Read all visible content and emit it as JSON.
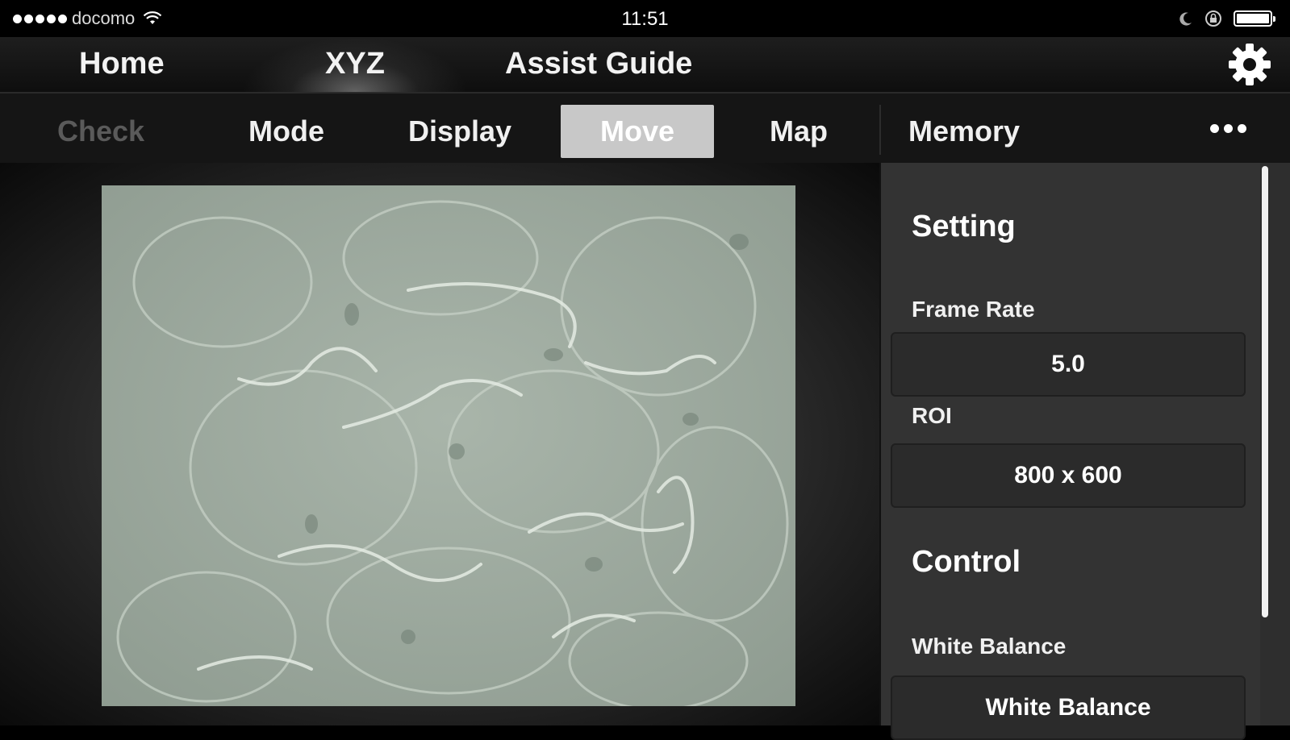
{
  "status_bar": {
    "carrier": "docomo",
    "time": "11:51"
  },
  "top_nav": {
    "items": [
      {
        "label": "Home",
        "active": false
      },
      {
        "label": "XYZ",
        "active": true
      },
      {
        "label": "Assist Guide",
        "active": false
      }
    ],
    "settings_icon": "gear-icon"
  },
  "toolbar": {
    "items": [
      {
        "label": "Check",
        "state": "disabled"
      },
      {
        "label": "Mode",
        "state": "normal"
      },
      {
        "label": "Display",
        "state": "normal"
      },
      {
        "label": "Move",
        "state": "selected"
      },
      {
        "label": "Map",
        "state": "normal"
      },
      {
        "label": "Memory",
        "state": "normal"
      }
    ],
    "more_icon": "more-dots-icon"
  },
  "viewer": {
    "image": "microscope-live-image-cells"
  },
  "panel": {
    "setting": {
      "heading": "Setting",
      "frame_rate_label": "Frame Rate",
      "frame_rate_value": "5.0",
      "roi_label": "ROI",
      "roi_value": "800 x 600"
    },
    "control": {
      "heading": "Control",
      "white_balance_label": "White Balance",
      "white_balance_button": "White Balance"
    }
  },
  "colors": {
    "background": "#000000",
    "panel": "#333333",
    "selected_tab": "#c8c8c8",
    "disabled_text": "#5a5a5a"
  }
}
